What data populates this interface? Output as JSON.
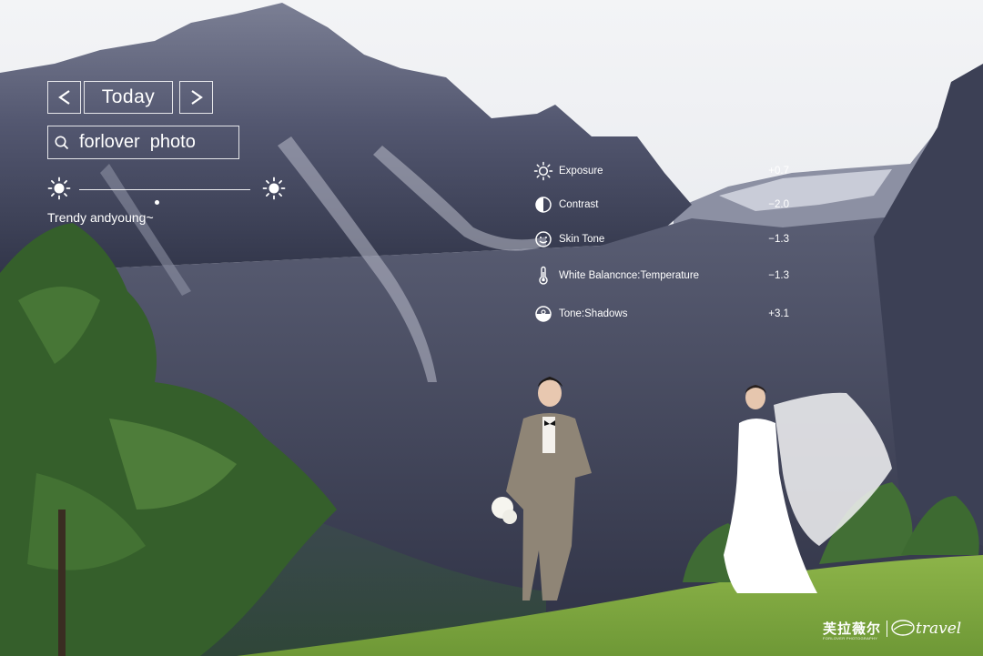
{
  "navigation": {
    "prev_icon": "chevron-left-icon",
    "today_label": "Today",
    "next_icon": "chevron-right-icon"
  },
  "search": {
    "icon": "search-icon",
    "value": "forlover  photo"
  },
  "brightness": {
    "left_icon": "sun-icon",
    "right_icon": "sun-icon",
    "level": 0.45
  },
  "tagline": "Trendy andyoung~",
  "adjustments": [
    {
      "icon": "sun-icon",
      "label": "Exposure",
      "value": "+0.7"
    },
    {
      "icon": "contrast-icon",
      "label": "Contrast",
      "value": "−2.0"
    },
    {
      "icon": "smiley-icon",
      "label": "Skin Tone",
      "value": "−1.3"
    },
    {
      "icon": "thermometer-icon",
      "label": "White Balancnce:Temperature",
      "value": "−1.3"
    },
    {
      "icon": "shadows-icon",
      "label": "Tone:Shadows",
      "value": "+3.1"
    }
  ],
  "watermark": {
    "chinese": "芙拉薇尔",
    "sub": "FORLOVER PHOTOGRAPHY",
    "travel": "travel"
  },
  "colors": {
    "overlay_text": "#ffffff",
    "sky": "#eef0f3",
    "mountain": "#4d5168",
    "grass": "#7da63e",
    "tree": "#3a6b2e"
  }
}
